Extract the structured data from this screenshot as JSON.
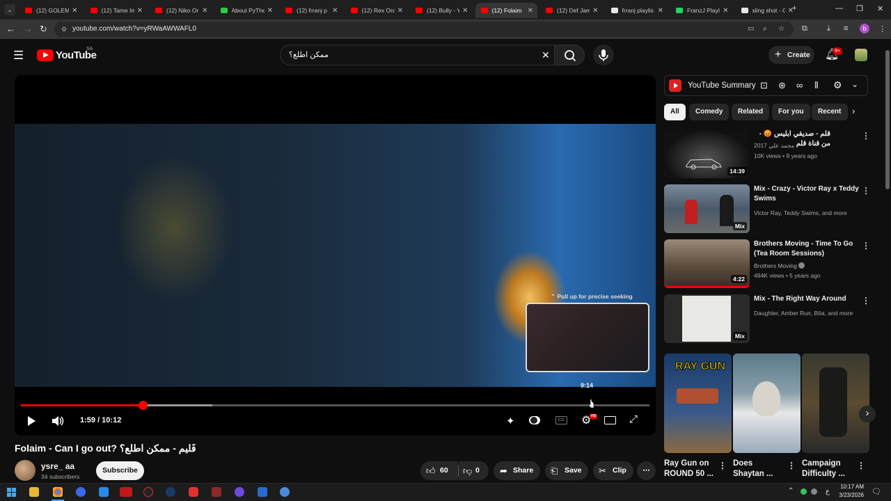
{
  "browser": {
    "tabs": [
      {
        "label": "(12) GOLEM",
        "fav": "#ff0000"
      },
      {
        "label": "(12) Tame Im",
        "fav": "#ff0000"
      },
      {
        "label": "(12) Niko Or",
        "fav": "#ff0000"
      },
      {
        "label": "About PyThe",
        "fav": "#2ecc40"
      },
      {
        "label": "(12) frranj p",
        "fav": "#ff0000"
      },
      {
        "label": "(12) Rex Ora",
        "fav": "#ff0000"
      },
      {
        "label": "(12) Bully - Y",
        "fav": "#ff0000"
      },
      {
        "label": "(12) Folaim",
        "fav": "#ff0000",
        "active": true
      },
      {
        "label": "(12) Def Jam",
        "fav": "#ff0000"
      },
      {
        "label": "frranj playlis",
        "fav": "#e8e8e8"
      },
      {
        "label": "FranzJ Playlis",
        "fav": "#1ed760"
      },
      {
        "label": "sling shot - G",
        "fav": "#e8e8e8"
      }
    ],
    "new_tab": "+",
    "url": "youtube.com/watch?v=yRWaAWWAFL0",
    "profile_initial": "b"
  },
  "youtube": {
    "logo_text": "YouTube",
    "region": "SA",
    "search_value": "ممكن اطلع؟",
    "create_label": "Create",
    "notif_count": "9+"
  },
  "player": {
    "tooltip": "Pull up for precise seeking",
    "hover_time": "9:14",
    "time_display": "1:59 / 10:12",
    "progress_fraction": 0.194,
    "buffered_fraction": 0.305,
    "hd_badge": "HD"
  },
  "video": {
    "title": "Folaim - Can I go out? فَليم - ممكن اطلع؟",
    "channel": "ysre_ aa",
    "subscribers": "34 subscribers",
    "subscribe_label": "Subscribe",
    "likes": "60",
    "dislikes": "0",
    "share_label": "Share",
    "save_label": "Save",
    "clip_label": "Clip"
  },
  "sidebar": {
    "summary_title": "YouTube Summary",
    "chips": [
      "All",
      "Comedy",
      "Related",
      "For you",
      "Recent"
    ],
    "recommendations": [
      {
        "title": "قلم - صديقي ابليس 😡 - من قناة قلم",
        "channel": "محمد علي 2017",
        "meta": "10K views • 9 years ago",
        "badge": "14:39"
      },
      {
        "title": "Mix - Crazy - Victor Ray x Teddy Swims",
        "channel": "Victor Ray, Teddy Swims, and more",
        "meta": "",
        "badge": "Mix"
      },
      {
        "title": "Brothers Moving - Time To Go (Tea Room Sessions)",
        "channel": "Brothers Moving",
        "meta": "494K views • 5 years ago",
        "badge": "4:22"
      },
      {
        "title": "Mix - The Right Way Around",
        "channel": "Daughter, Amber Run, Bôa, and more",
        "meta": "",
        "badge": "Mix"
      }
    ],
    "shorts": [
      {
        "title": "Ray Gun on ROUND 50 ...",
        "overlay": "RAY GUN"
      },
      {
        "title": "Does Shaytan ...",
        "overlay": ""
      },
      {
        "title": "Campaign Difficulty ...",
        "overlay": ""
      }
    ]
  },
  "taskbar": {
    "time": "10:17 AM",
    "date": "3/23/2026",
    "lang": "ع"
  }
}
